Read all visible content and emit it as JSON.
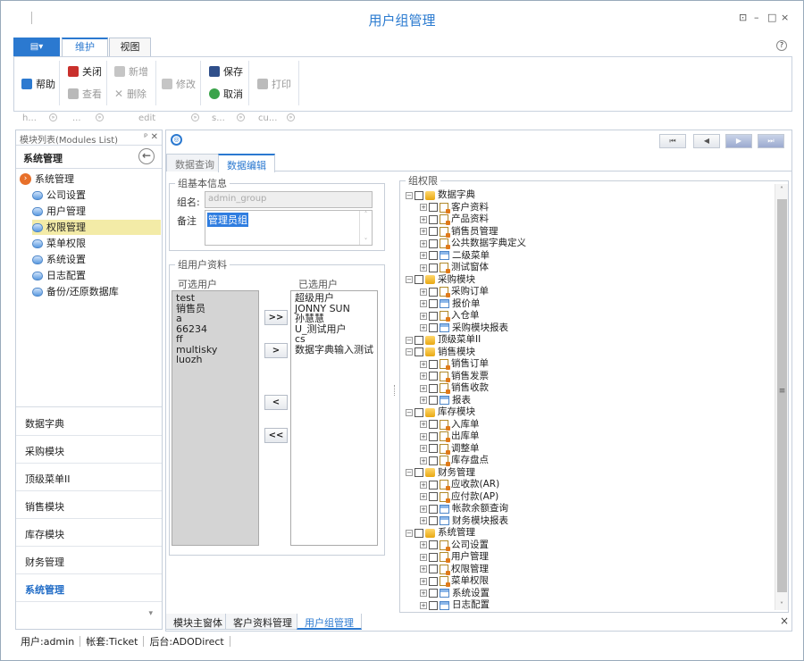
{
  "window": {
    "title": "用户组管理",
    "controls": [
      "⊡",
      "–",
      "□",
      "×"
    ]
  },
  "ribbon": {
    "file_label": "▤▾",
    "tabs": [
      "维护",
      "视图"
    ],
    "help_label": "?",
    "buttons": {
      "help": "帮助",
      "close": "关闭",
      "view": "查看",
      "new": "新增",
      "delete": "删除",
      "edit": "修改",
      "save": "保存",
      "cancel": "取消",
      "print": "打印"
    },
    "groups": [
      "h...",
      "...",
      "edit",
      "s...",
      "cu..."
    ]
  },
  "left_panel": {
    "header": "模块列表(Modules List)",
    "header_buttons": [
      "ᵖ",
      "✕"
    ],
    "subheader": "系统管理",
    "back": "←",
    "tree_root": "系统管理",
    "tree_items": [
      "公司设置",
      "用户管理",
      "权限管理",
      "菜单权限",
      "系统设置",
      "日志配置",
      "备份/还原数据库"
    ],
    "nav": [
      "数据字典",
      "采购模块",
      "顶级菜单II",
      "销售模块",
      "库存模块",
      "财务管理",
      "系统管理"
    ],
    "nav_more": "▾"
  },
  "pager": {
    "first": "⏮",
    "prev": "◀",
    "next": "▶",
    "last": "⏭",
    "nav_icon": "◎"
  },
  "tabs": [
    "数据查询",
    "数据编辑"
  ],
  "group_info": {
    "legend": "组基本信息",
    "name_label": "组名:",
    "name_value": "admin_group",
    "remark_label": "备注",
    "remark_value": "管理员组",
    "scroll_up": "˄",
    "scroll_down": "˅"
  },
  "users": {
    "legend": "组用户资料",
    "available_legend": "可选用户",
    "available": [
      "test",
      "销售员",
      "a",
      "66234",
      "ff",
      "multisky",
      "luozh"
    ],
    "selected_legend": "已选用户",
    "selected": [
      "超级用户",
      "JONNY SUN",
      "孙慧慧",
      "U_测试用户",
      "cs",
      "数据字典输入测试"
    ],
    "buttons": [
      ">>",
      ">",
      "<",
      "<<"
    ]
  },
  "permissions": {
    "legend": "组权限",
    "tree": [
      {
        "label": "数据字典",
        "level": 0,
        "type": "group"
      },
      {
        "label": "客户资料",
        "level": 1,
        "type": "doc"
      },
      {
        "label": "产品资料",
        "level": 1,
        "type": "doc"
      },
      {
        "label": "销售员管理",
        "level": 1,
        "type": "doc"
      },
      {
        "label": "公共数据字典定义",
        "level": 1,
        "type": "doc"
      },
      {
        "label": "二级菜单",
        "level": 1,
        "type": "form"
      },
      {
        "label": "测试窗体",
        "level": 1,
        "type": "doc"
      },
      {
        "label": "采购模块",
        "level": 0,
        "type": "group"
      },
      {
        "label": "采购订单",
        "level": 1,
        "type": "doc"
      },
      {
        "label": "报价单",
        "level": 1,
        "type": "form"
      },
      {
        "label": "入仓单",
        "level": 1,
        "type": "doc"
      },
      {
        "label": "采购模块报表",
        "level": 1,
        "type": "form"
      },
      {
        "label": "顶级菜单II",
        "level": 0,
        "type": "group"
      },
      {
        "label": "销售模块",
        "level": 0,
        "type": "group"
      },
      {
        "label": "销售订单",
        "level": 1,
        "type": "doc"
      },
      {
        "label": "销售发票",
        "level": 1,
        "type": "doc"
      },
      {
        "label": "销售收款",
        "level": 1,
        "type": "doc"
      },
      {
        "label": "报表",
        "level": 1,
        "type": "form"
      },
      {
        "label": "库存模块",
        "level": 0,
        "type": "group"
      },
      {
        "label": "入库单",
        "level": 1,
        "type": "doc"
      },
      {
        "label": "出库单",
        "level": 1,
        "type": "doc"
      },
      {
        "label": "调整单",
        "level": 1,
        "type": "doc"
      },
      {
        "label": "库存盘点",
        "level": 1,
        "type": "doc"
      },
      {
        "label": "财务管理",
        "level": 0,
        "type": "group"
      },
      {
        "label": "应收款(AR)",
        "level": 1,
        "type": "doc"
      },
      {
        "label": "应付款(AP)",
        "level": 1,
        "type": "doc"
      },
      {
        "label": "帐款余额查询",
        "level": 1,
        "type": "form"
      },
      {
        "label": "财务模块报表",
        "level": 1,
        "type": "form"
      },
      {
        "label": "系统管理",
        "level": 0,
        "type": "group"
      },
      {
        "label": "公司设置",
        "level": 1,
        "type": "doc"
      },
      {
        "label": "用户管理",
        "level": 1,
        "type": "doc"
      },
      {
        "label": "权限管理",
        "level": 1,
        "type": "doc"
      },
      {
        "label": "菜单权限",
        "level": 1,
        "type": "doc"
      },
      {
        "label": "系统设置",
        "level": 1,
        "type": "form"
      },
      {
        "label": "日志配置",
        "level": 1,
        "type": "form"
      }
    ],
    "scroll_grip": "≡",
    "scroll_up": "˄",
    "scroll_down": "˅"
  },
  "bottom_tabs": [
    "模块主窗体",
    "客户资料管理",
    "用户组管理"
  ],
  "bottom_close": "×",
  "status": [
    "用户:admin",
    "帐套:Ticket",
    "后台:ADODirect"
  ]
}
